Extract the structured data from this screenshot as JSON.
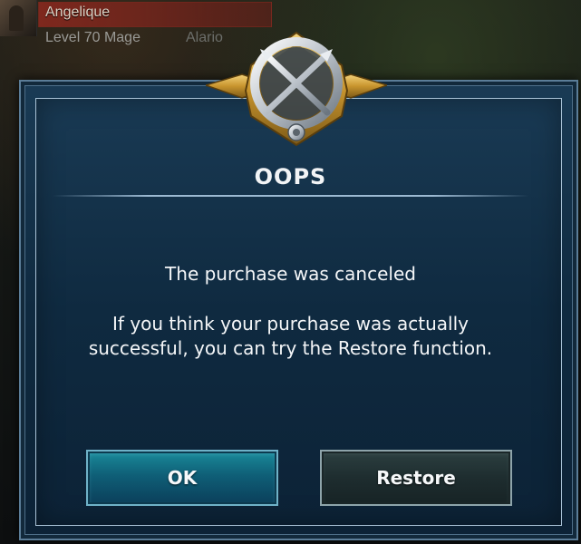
{
  "player": {
    "name": "Angelique",
    "level_text": "Level 70 Mage",
    "guild": "Alario"
  },
  "dialog": {
    "title": "OOPS",
    "message_line1": "The purchase was canceled",
    "message_line2": "If you think your purchase was actually successful, you can try the Restore function.",
    "emblem_icon": "crossed-blades-emblem-icon"
  },
  "buttons": {
    "ok_label": "OK",
    "restore_label": "Restore"
  },
  "colors": {
    "dialog_bg": "#12304a",
    "ok_button": "#127086",
    "restore_button": "#223334",
    "emblem_gold": "#d1a43a",
    "emblem_silver": "#c9ced4"
  }
}
